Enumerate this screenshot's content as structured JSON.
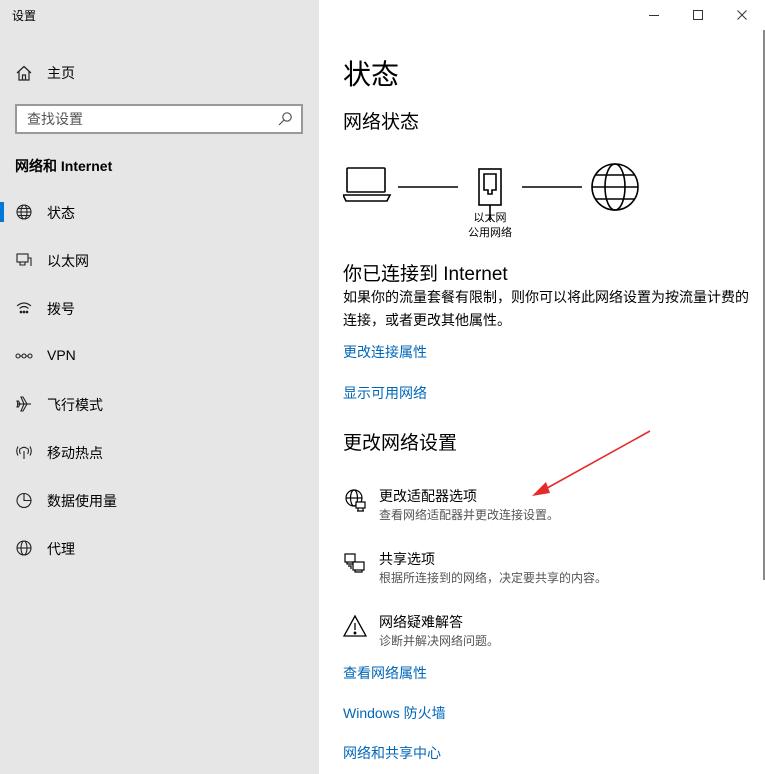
{
  "window": {
    "title": "设置"
  },
  "sidebar": {
    "home_label": "主页",
    "search_placeholder": "查找设置",
    "section_heading": "网络和 Internet",
    "items": [
      {
        "label": "状态",
        "icon": "globe-status-icon",
        "active": true
      },
      {
        "label": "以太网",
        "icon": "ethernet-icon"
      },
      {
        "label": "拨号",
        "icon": "dialup-icon"
      },
      {
        "label": "VPN",
        "icon": "vpn-icon"
      },
      {
        "label": "飞行模式",
        "icon": "airplane-icon"
      },
      {
        "label": "移动热点",
        "icon": "hotspot-icon"
      },
      {
        "label": "数据使用量",
        "icon": "data-usage-icon"
      },
      {
        "label": "代理",
        "icon": "proxy-globe-icon"
      }
    ]
  },
  "main": {
    "page_title": "状态",
    "network_status_heading": "网络状态",
    "diagram": {
      "adapter_label_line1": "以太网",
      "adapter_label_line2": "公用网络"
    },
    "connected_title": "你已连接到 Internet",
    "connected_desc": "如果你的流量套餐有限制，则你可以将此网络设置为按流量计费的连接，或者更改其他属性。",
    "links_top": {
      "change_properties": "更改连接属性",
      "show_available": "显示可用网络"
    },
    "change_settings_heading": "更改网络设置",
    "options": [
      {
        "title": "更改适配器选项",
        "desc": "查看网络适配器并更改连接设置。",
        "icon": "adapter-globe-icon"
      },
      {
        "title": "共享选项",
        "desc": "根据所连接到的网络，决定要共享的内容。",
        "icon": "sharing-icon"
      },
      {
        "title": "网络疑难解答",
        "desc": "诊断并解决网络问题。",
        "icon": "warning-icon"
      }
    ],
    "links_bottom": {
      "view_properties": "查看网络属性",
      "firewall": "Windows 防火墙",
      "sharing_center": "网络和共享中心"
    }
  },
  "annotation": {
    "arrow_color": "#e52a2a"
  },
  "colors": {
    "accent": "#0078d7",
    "link": "#0067b8",
    "sidebar_bg": "#e6e6e6"
  }
}
